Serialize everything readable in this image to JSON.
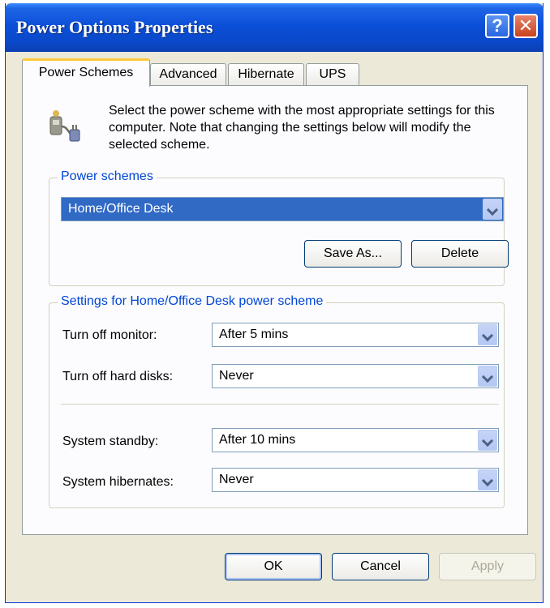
{
  "window": {
    "title": "Power Options Properties",
    "help_glyph": "?",
    "close_glyph": "✕"
  },
  "tabs": [
    {
      "label": "Power Schemes",
      "active": true
    },
    {
      "label": "Advanced",
      "active": false
    },
    {
      "label": "Hibernate",
      "active": false
    },
    {
      "label": "UPS",
      "active": false
    }
  ],
  "intro": {
    "icon": "power-plug-icon",
    "text": "Select the power scheme with the most appropriate settings for this computer. Note that changing the settings below will modify the selected scheme."
  },
  "power_schemes": {
    "group_label": "Power schemes",
    "selected": "Home/Office Desk",
    "save_as_label": "Save As...",
    "delete_label": "Delete"
  },
  "settings": {
    "group_label": "Settings for Home/Office Desk power scheme",
    "turn_off_monitor": {
      "label": "Turn off monitor:",
      "value": "After 5 mins"
    },
    "turn_off_hard_disks": {
      "label": "Turn off hard disks:",
      "value": "Never"
    },
    "system_standby": {
      "label": "System standby:",
      "value": "After 10 mins"
    },
    "system_hibernates": {
      "label": "System hibernates:",
      "value": "Never"
    }
  },
  "footer": {
    "ok_label": "OK",
    "cancel_label": "Cancel",
    "apply_label": "Apply"
  },
  "colors": {
    "titlebar": "#0B4FD8",
    "group_label": "#0046D5",
    "selection": "#316AC5",
    "dialog_bg": "#ECE9D8"
  }
}
